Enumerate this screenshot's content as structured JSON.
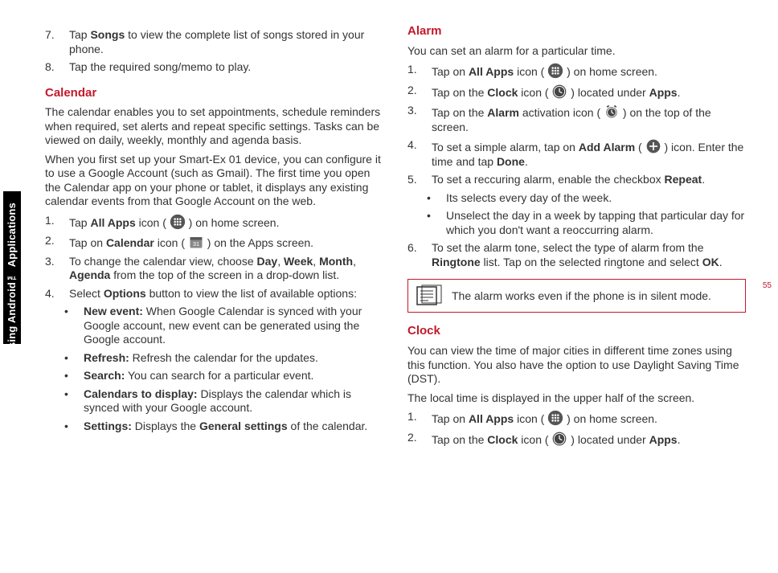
{
  "sidebar_label": "Using Android™ Applications",
  "page_number": "55",
  "col1": {
    "step7": {
      "n": "7.",
      "pre": "Tap ",
      "b": "Songs",
      "post": " to view the complete list of songs stored in your phone."
    },
    "step8": {
      "n": "8.",
      "t": "Tap the required song/memo to play."
    },
    "calendar_head": "Calendar",
    "cal_p1": "The calendar enables you to set appointments, schedule reminders when required, set alerts and repeat specific settings. Tasks can be viewed on daily, weekly, monthly and agenda basis.",
    "cal_p2": "When you first set up your Smart-Ex 01 device, you can configure it to use a Google Account (such as Gmail). The first time you open the Calendar app on your phone or tablet, it displays any existing calendar events from that Google Account on the web.",
    "cal_s1": {
      "n": "1.",
      "pre": "Tap ",
      "b": "All Apps",
      "mid": " icon ( ",
      "post": " ) on home screen."
    },
    "cal_s2": {
      "n": "2.",
      "pre": "Tap on ",
      "b": "Calendar",
      "mid": " icon ( ",
      "post": " ) on the Apps screen."
    },
    "cal_s3": {
      "n": "3.",
      "pre": "To change the calendar view, choose ",
      "b1": "Day",
      "c1": ", ",
      "b2": "Week",
      "c2": ", ",
      "b3": "Month",
      "c3": ", ",
      "b4": "Agenda",
      "post": " from the top of the screen in a drop-down list."
    },
    "cal_s4": {
      "n": "4.",
      "pre": "Select ",
      "b": "Options",
      "post": " button to view the list of available options:"
    },
    "opt1": {
      "b": "New event:",
      "t": " When Google Calendar is synced with your Google account, new event can be generated using the Google account."
    },
    "opt2": {
      "b": "Refresh:",
      "t": " Refresh the calendar for the updates."
    },
    "opt3": {
      "b": "Search:",
      "t": " You can search for a particular event."
    },
    "opt4": {
      "b": "Calendars to display:",
      "t": " Displays the calendar which is synced with your Google account."
    },
    "opt5": {
      "b": "Settings:",
      "pre": " Displays the ",
      "b2": "General settings",
      "post": " of the calendar."
    }
  },
  "col2": {
    "alarm_head": "Alarm",
    "al_p1": "You can set an alarm for a particular time.",
    "al_s1": {
      "n": "1.",
      "pre": "Tap on ",
      "b": "All Apps",
      "mid": " icon ( ",
      "post": " ) on home screen."
    },
    "al_s2": {
      "n": "2.",
      "pre": "Tap on the ",
      "b": "Clock",
      "mid": " icon ( ",
      "post1": " ) located under ",
      "b2": "Apps",
      "post2": "."
    },
    "al_s3": {
      "n": "3.",
      "pre": "Tap on the ",
      "b": "Alarm",
      "mid": " activation icon ( ",
      "post": " ) on the top of the screen."
    },
    "al_s4": {
      "n": "4.",
      "pre": "To set a simple alarm, tap on ",
      "b": "Add Alarm",
      "mid": " ( ",
      "post1": " ) icon. Enter the time and tap ",
      "b2": "Done",
      "post2": "."
    },
    "al_s5": {
      "n": "5.",
      "pre": "To set a reccuring alarm, enable the checkbox ",
      "b": "Repeat",
      "post": "."
    },
    "al_b1": "Its selects every day of the week.",
    "al_b2": "Unselect the day in a week by tapping that particular day for which you don't want a reoccurring alarm.",
    "al_s6": {
      "n": "6.",
      "pre": "To set the alarm tone, select the type of alarm from the ",
      "b": "Ringtone",
      "post1": " list. Tap on the selected ringtone and select ",
      "b2": "OK",
      "post2": "."
    },
    "note": "The alarm works even if the phone is in silent mode.",
    "clock_head": "Clock",
    "cl_p1": "You can view the time of major cities in different time zones using this function. You also have the option to use Daylight Saving Time (DST).",
    "cl_p2": "The local time is displayed in the upper half of the screen.",
    "cl_s1": {
      "n": "1.",
      "pre": "Tap on ",
      "b": "All Apps",
      "mid": " icon ( ",
      "post": " ) on home screen."
    },
    "cl_s2": {
      "n": "2.",
      "pre": "Tap on the ",
      "b": "Clock",
      "mid": " icon ( ",
      "post1": " ) located under ",
      "b2": "Apps",
      "post2": "."
    }
  }
}
